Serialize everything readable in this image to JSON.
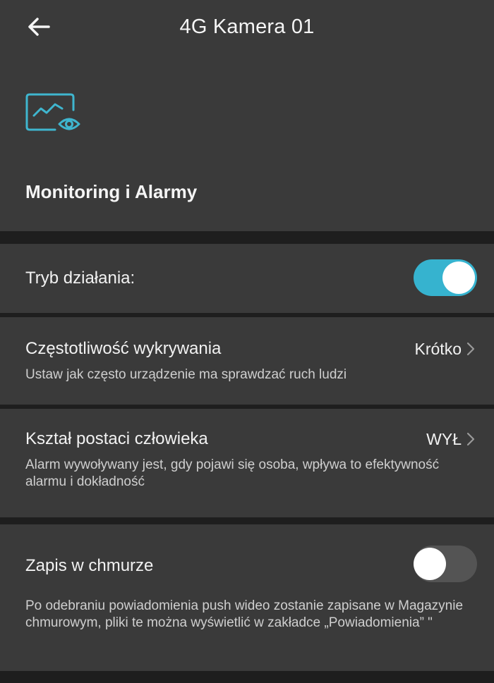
{
  "header": {
    "title": "4G Kamera 01",
    "back_icon": "arrow-left-icon",
    "section_icon": "monitor-eye-icon",
    "section_title": "Monitoring i Alarmy"
  },
  "settings": {
    "mode": {
      "label": "Tryb działania:",
      "toggle_on": true
    },
    "frequency": {
      "label": "Częstotliwość wykrywania",
      "value": "Krótko",
      "description": "Ustaw jak często urządzenie ma sprawdzać ruch ludzi"
    },
    "human_shape": {
      "label": "Kształ postaci człowieka",
      "value": "WYŁ",
      "description": "Alarm wywoływany jest, gdy pojawi się osoba, wpływa to efektywność alarmu i dokładność"
    },
    "cloud": {
      "label": "Zapis w chmurze",
      "toggle_on": false,
      "description": " Po odebraniu powiadomienia push wideo zostanie zapisane w Magazynie chmurowym, pliki te można wyświetlić w zakładce „Powiadomienia” \""
    }
  },
  "colors": {
    "accent": "#36b3cf",
    "panel": "#3a3a3a",
    "separator": "#1e1e1e"
  }
}
